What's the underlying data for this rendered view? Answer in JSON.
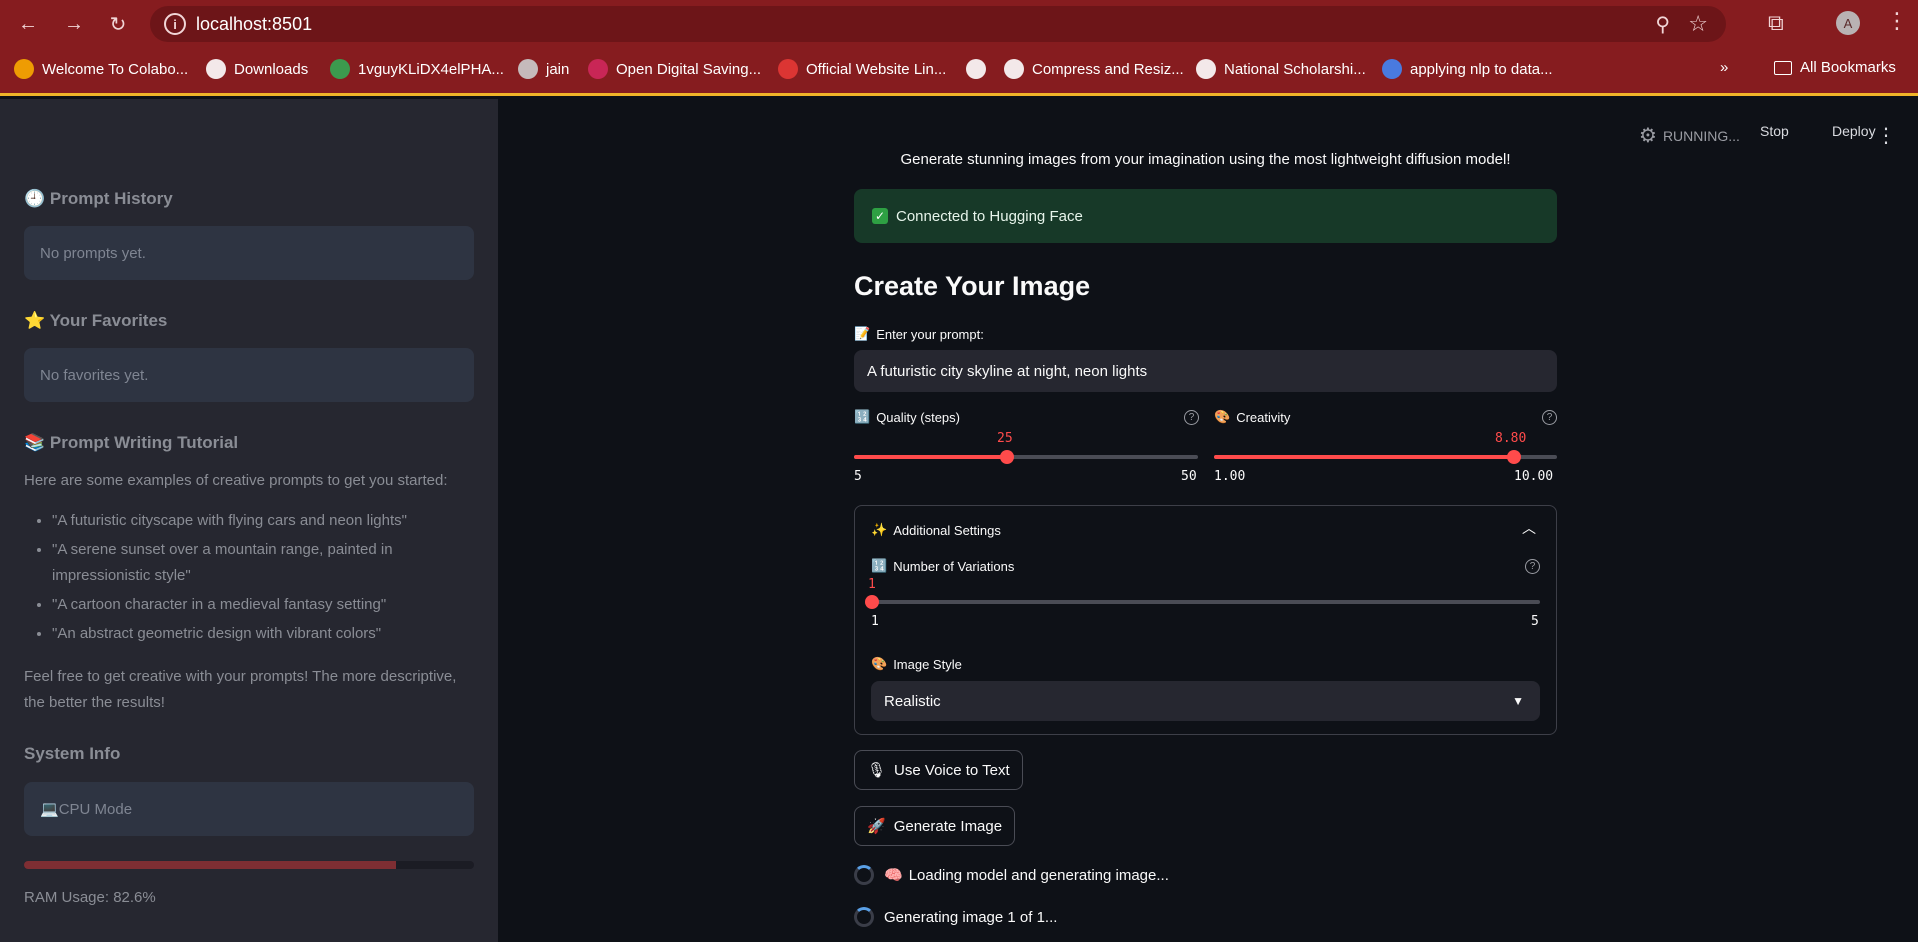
{
  "browser": {
    "url": "localhost:8501",
    "avatar_letter": "A",
    "bookmarks": [
      {
        "label": "Welcome To Colabo...",
        "icon": "colab-icon",
        "color": "#f9ab00"
      },
      {
        "label": "Downloads",
        "icon": "download-icon",
        "color": "#ffffff"
      },
      {
        "label": "1vguyKLiDX4elPHA...",
        "icon": "google-drive-icon",
        "color": "#34a853"
      },
      {
        "label": "jain",
        "icon": "robot-icon",
        "color": "#cccccc"
      },
      {
        "label": "Open Digital Saving...",
        "icon": "bank-icon",
        "color": "#d0285c"
      },
      {
        "label": "Official Website Lin...",
        "icon": "brand-icon",
        "color": "#e53935"
      },
      {
        "label": "",
        "icon": "globe-icon",
        "color": "#ffffff"
      },
      {
        "label": "Compress and Resiz...",
        "icon": "globe-icon",
        "color": "#ffffff"
      },
      {
        "label": "National Scholarshi...",
        "icon": "globe-icon",
        "color": "#ffffff"
      },
      {
        "label": "applying nlp to data...",
        "icon": "google-icon",
        "color": "#4285f4"
      }
    ],
    "more_label": "»",
    "all_bookmarks": "All Bookmarks"
  },
  "sidebar": {
    "history_title": "Prompt History",
    "history_empty": "No prompts yet.",
    "favorites_title": "Your Favorites",
    "favorites_empty": "No favorites yet.",
    "tutorial_title": "Prompt Writing Tutorial",
    "tutorial_intro": "Here are some examples of creative prompts to get you started:",
    "examples": [
      "\"A futuristic cityscape with flying cars and neon lights\"",
      "\"A serene sunset over a mountain range, painted in impressionistic style\"",
      "\"A cartoon character in a medieval fantasy setting\"",
      "\"An abstract geometric design with vibrant colors\""
    ],
    "tutorial_outro": "Feel free to get creative with your prompts! The more descriptive, the better the results!",
    "system_title": "System Info",
    "cpu_mode": "CPU Mode",
    "ram_label": "RAM Usage: 82.6%",
    "ram_fraction": 0.826
  },
  "header": {
    "running": "RUNNING...",
    "stop": "Stop",
    "deploy": "Deploy"
  },
  "main": {
    "subtitle": "Generate stunning images from your imagination using the most lightweight diffusion model!",
    "success_msg": "Connected to Hugging Face",
    "heading": "Create Your Image",
    "prompt_label": "Enter your prompt:",
    "prompt_value": "A futuristic city skyline at night, neon lights",
    "quality": {
      "label": "Quality (steps)",
      "value": "25",
      "min": "5",
      "max": "50"
    },
    "creativity": {
      "label": "Creativity",
      "value": "8.80",
      "min": "1.00",
      "max": "10.00"
    },
    "additional_settings": "Additional Settings",
    "variations": {
      "label": "Number of Variations",
      "value": "1",
      "min": "1",
      "max": "5"
    },
    "style_label": "Image Style",
    "style_value": "Realistic",
    "voice_button": "Use Voice to Text",
    "generate_button": "Generate Image",
    "loading_msg": "Loading model and generating image...",
    "generating_msg": "Generating image 1 of 1..."
  }
}
